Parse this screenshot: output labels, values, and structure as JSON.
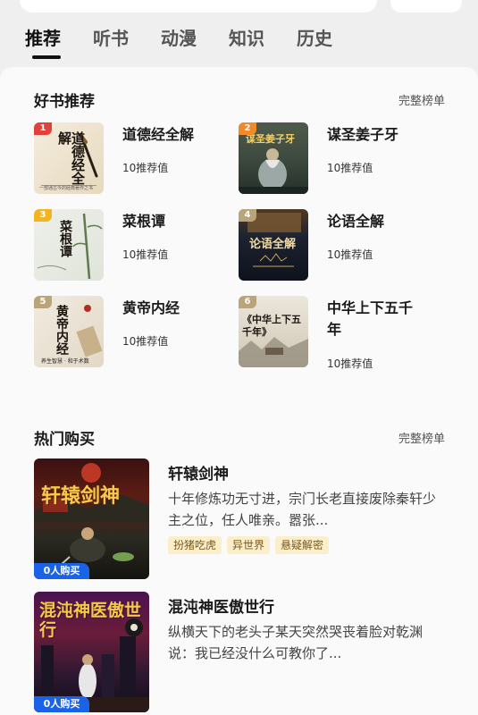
{
  "tabs": [
    {
      "label": "推荐",
      "active": true
    },
    {
      "label": "听书"
    },
    {
      "label": "动漫"
    },
    {
      "label": "知识"
    },
    {
      "label": "历史"
    }
  ],
  "good_books": {
    "title": "好书推荐",
    "more_label": "完整榜单",
    "items": [
      {
        "rank": "1",
        "title": "道德经全解",
        "rec": "10推荐值",
        "cover_text": "道德经全解",
        "cover_caption": "一部通古今的经典著作之书",
        "rank_color": "#e0413a"
      },
      {
        "rank": "2",
        "title": "谋圣姜子牙",
        "rec": "10推荐值",
        "cover_text": "谋圣姜子牙",
        "rank_color": "#f08a2a"
      },
      {
        "rank": "3",
        "title": "菜根谭",
        "rec": "10推荐值",
        "cover_text": "菜根谭",
        "rank_color": "#f2b51f"
      },
      {
        "rank": "4",
        "title": "论语全解",
        "rec": "10推荐值",
        "cover_text": "论语全解",
        "rank_color": "#b9a47c"
      },
      {
        "rank": "5",
        "title": "黄帝内经",
        "rec": "10推荐值",
        "cover_text": "黄帝内经",
        "cover_caption": "养生智慧 · 和于术数",
        "rank_color": "#b9a47c"
      },
      {
        "rank": "6",
        "title": "中华上下五千年",
        "rec": "10推荐值",
        "cover_text": "《中华上下五千年》",
        "rank_color": "#b9a47c"
      }
    ]
  },
  "hot_buy": {
    "title": "热门购买",
    "more_label": "完整榜单",
    "items": [
      {
        "title": "轩辕剑神",
        "desc": "十年修炼功无寸进，宗门长老直接废除秦轩少主之位，任人唯亲。嚣张...",
        "tags": [
          "扮猪吃虎",
          "异世界",
          "悬疑解密"
        ],
        "badge": "0人购买",
        "cover_text": "轩辕剑神"
      },
      {
        "title": "混沌神医傲世行",
        "desc": "纵横天下的老头子某天突然哭丧着脸对乾渊说：我已经没什么可教你了...",
        "tags": [],
        "badge": "0人购买",
        "cover_text": "混沌神医傲世行"
      }
    ]
  },
  "colors": {
    "accent_blue": "#1b63e6",
    "tag_bg": "#fbeeca"
  }
}
